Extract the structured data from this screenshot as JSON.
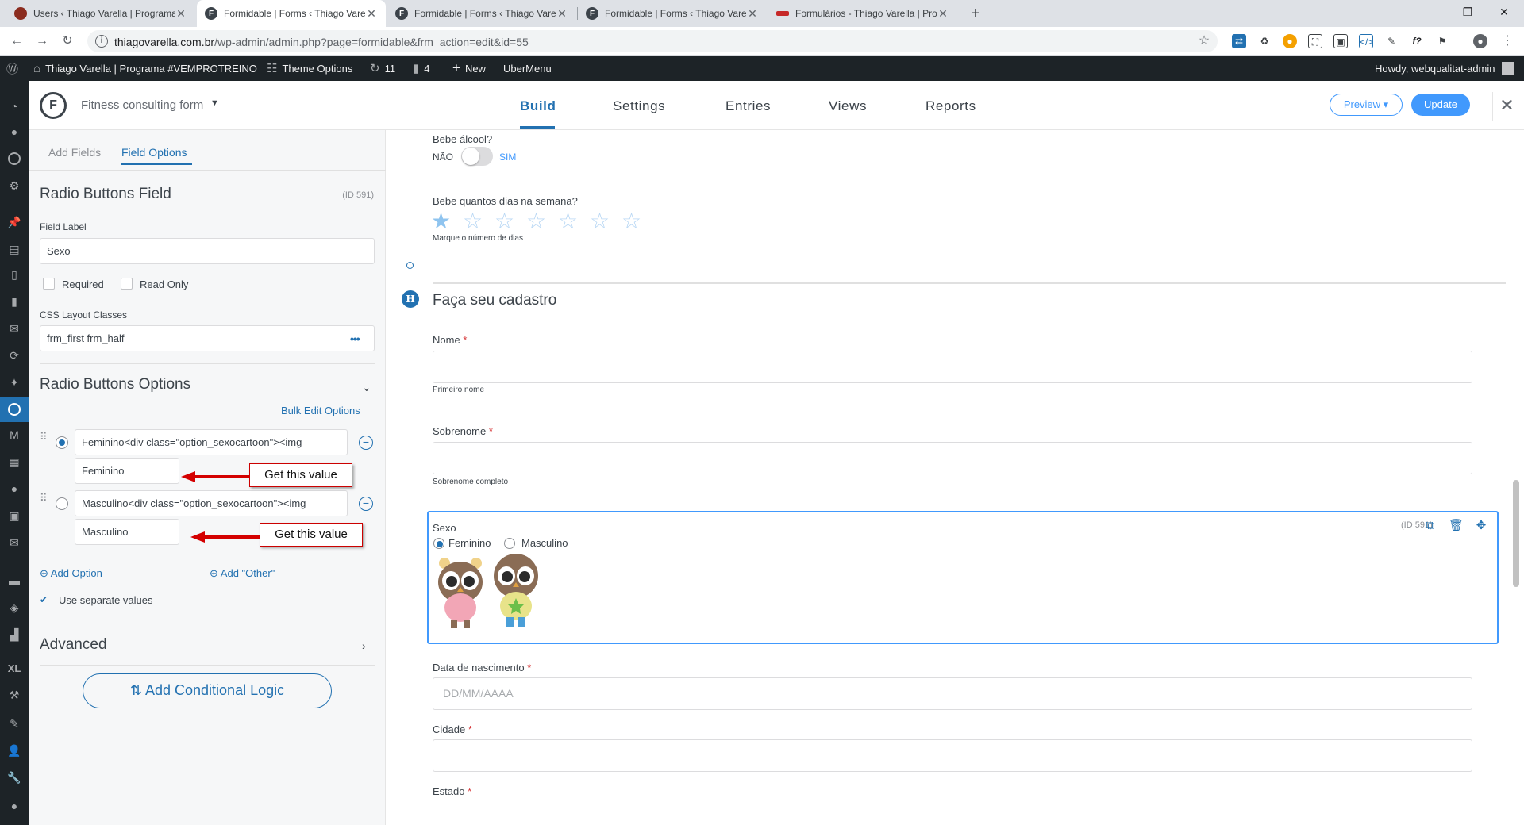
{
  "browser": {
    "tabs": [
      {
        "title": "Users ‹ Thiago Varella | Programa",
        "fav_color": "#8b2c1f",
        "fav_glyph": "●",
        "active": false
      },
      {
        "title": "Formidable | Forms ‹ Thiago Vare",
        "fav_color": "#3c434a",
        "fav_glyph": "F",
        "active": true
      },
      {
        "title": "Formidable | Forms ‹ Thiago Vare",
        "fav_color": "#3c434a",
        "fav_glyph": "F",
        "active": false
      },
      {
        "title": "Formidable | Forms ‹ Thiago Vare",
        "fav_color": "#3c434a",
        "fav_glyph": "F",
        "active": false
      },
      {
        "title": "Formulários - Thiago Varella | Pro",
        "fav_color": "#c62828",
        "fav_glyph": "~",
        "active": false
      }
    ],
    "url_host": "thiagovarella.com.br",
    "url_path": "/wp-admin/admin.php?page=formidable&frm_action=edit&id=55"
  },
  "adminbar": {
    "site_name": "Thiago Varella | Programa #VEMPROTREINO",
    "theme_options": "Theme Options",
    "updates_count": "11",
    "comments_count": "4",
    "new_label": "New",
    "ubermenu": "UberMenu",
    "howdy": "Howdy, webqualitat-admin"
  },
  "builder": {
    "form_name": "Fitness consulting form",
    "tabs": [
      "Build",
      "Settings",
      "Entries",
      "Views",
      "Reports"
    ],
    "preview_label": "Preview ▾",
    "update_label": "Update",
    "close_label": "✕"
  },
  "sidebar": {
    "tab_add_fields": "Add Fields",
    "tab_field_options": "Field Options",
    "field_title": "Radio Buttons Field",
    "field_id": "(ID 591)",
    "field_label_label": "Field Label",
    "field_label_value": "Sexo",
    "required_label": "Required",
    "readonly_label": "Read Only",
    "css_classes_label": "CSS Layout Classes",
    "css_classes_value": "frm_first frm_half",
    "options_title": "Radio Buttons Options",
    "bulk_edit": "Bulk Edit Options",
    "options": [
      {
        "label": "Feminino<div class=\"option_sexocartoon\"><img",
        "value": "Feminino",
        "selected": true
      },
      {
        "label": "Masculino<div class=\"option_sexocartoon\"><img",
        "value": "Masculino",
        "selected": false
      }
    ],
    "add_option": "Add Option",
    "add_other": "Add \"Other\"",
    "use_separate": "Use separate values",
    "advanced": "Advanced",
    "conditional_logic": "Add Conditional Logic"
  },
  "annotations": [
    "Get this value",
    "Get this value"
  ],
  "canvas": {
    "alcohol_label": "Bebe álcool?",
    "alcohol_no": "NÃO",
    "alcohol_yes": "SIM",
    "days_label": "Bebe quantos dias na semana?",
    "days_desc": "Marque o número de dias",
    "stars_total": 7,
    "stars_selected": 1,
    "section_title": "Faça seu cadastro",
    "nome_label": "Nome",
    "nome_desc": "Primeiro nome",
    "sobrenome_label": "Sobrenome",
    "sobrenome_desc": "Sobrenome completo",
    "sexo_label": "Sexo",
    "sexo_id": "(ID 591)",
    "sexo_opt1": "Feminino",
    "sexo_opt2": "Masculino",
    "nascimento_label": "Data de nascimento",
    "nascimento_placeholder": "DD/MM/AAAA",
    "cidade_label": "Cidade",
    "estado_label": "Estado",
    "required_mark": "*"
  }
}
